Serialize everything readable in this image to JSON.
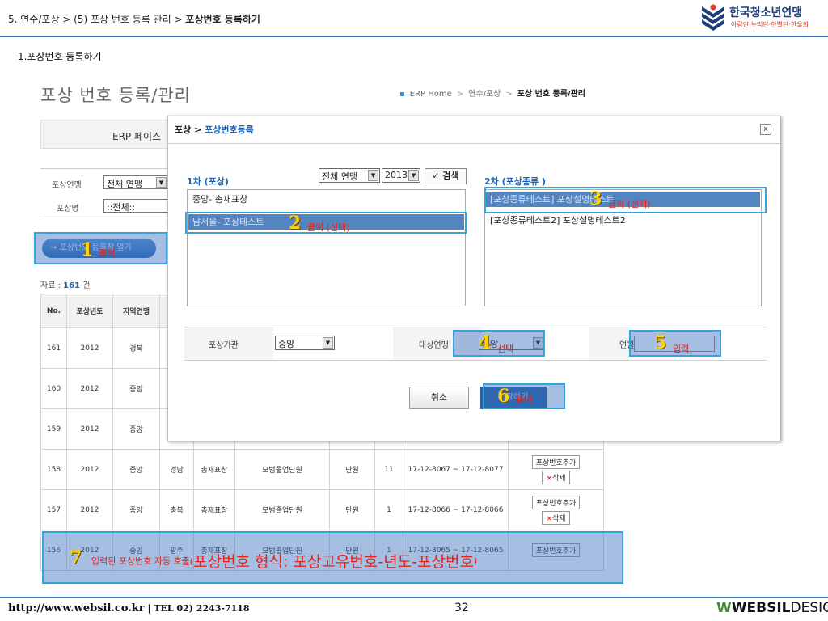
{
  "header": {
    "breadcrumb_path": "5. 연수/포상 > (5) 포상 번호 등록 관리 > ",
    "breadcrumb_current": "포상번호 등록하기",
    "brand_name": "한국청소년연맹",
    "brand_sub": "아람단·누리단·한별단·한울회"
  },
  "step_title": "1.포상번호 등록하기",
  "erp": {
    "page_title": "포상 번호 등록/관리",
    "crumbs": [
      "ERP Home",
      "연수/포상"
    ],
    "crumb_current": "포상 번호 등록/관리",
    "notice": "ERP 페이스",
    "filter": {
      "league_label": "포상연맹",
      "league_value": "전체 연맹",
      "award_label": "포상명",
      "award_value": "::전체::"
    },
    "open_button": "포상번호 등록창 열기",
    "count_label": "자료 : ",
    "count_value": "161",
    "count_unit": " 건",
    "table": {
      "headers": [
        "No.",
        "포상년도",
        "지역연맹"
      ],
      "rows": [
        {
          "no": "161",
          "year": "2012",
          "region": "경북"
        },
        {
          "no": "160",
          "year": "2012",
          "region": "중앙"
        },
        {
          "no": "159",
          "year": "2012",
          "region": "중앙"
        },
        {
          "no": "158",
          "year": "2012",
          "region": "중앙",
          "league": "경남",
          "award": "총재표창",
          "group": "모범졸업단원",
          "type": "단원",
          "qty": "11",
          "range": "17-12-8067 ~ 17-12-8077"
        },
        {
          "no": "157",
          "year": "2012",
          "region": "중앙",
          "league": "충북",
          "award": "총재표창",
          "group": "모범졸업단원",
          "type": "단원",
          "qty": "1",
          "range": "17-12-8066 ~ 17-12-8066"
        },
        {
          "no": "156",
          "year": "2012",
          "region": "중앙",
          "league": "광주",
          "award": "총재표창",
          "group": "모범졸업단원",
          "type": "단원",
          "qty": "1",
          "range": "17-12-8065 ~ 17-12-8065"
        }
      ],
      "add_button": "포상번호추가",
      "delete_button": "삭제"
    }
  },
  "modal": {
    "title_prefix": "포상 > ",
    "title_current": "포상번호등록",
    "close": "x",
    "first_label": "1차 (포상)",
    "first_league_select": "전체 연맹",
    "first_year_select": "2013",
    "search_button": "검색",
    "first_items": [
      "중앙- 총재표창",
      "남서울- 포상테스트"
    ],
    "second_label": "2차 (포상종류 )",
    "second_items": [
      "[포상종류테스트] 포상설명테스트",
      "[포상종류테스트2] 포상설명테스트2"
    ],
    "form": {
      "org_label": "포상기관",
      "org_value": "중앙",
      "target_label": "대상연맹",
      "target_value": "중앙",
      "year_label": "연월"
    },
    "cancel_button": "취소",
    "save_button": "저장하기"
  },
  "steps": {
    "s1": {
      "num": "1",
      "caption": "클릭"
    },
    "s2": {
      "num": "2",
      "caption": "클릭 (선택)"
    },
    "s3": {
      "num": "3",
      "caption": "클릭 (선택)"
    },
    "s4": {
      "num": "4",
      "caption": "선택"
    },
    "s5": {
      "num": "5",
      "caption": "입력"
    },
    "s6": {
      "num": "6",
      "caption": "클릭"
    },
    "s7": {
      "num": "7",
      "caption_small": "입력된 포상번호 자동 호출(",
      "caption_big": "포상번호 형식: 포상고유번호-년도-포상번호",
      "caption_end": ")"
    }
  },
  "footer": {
    "url": "http://www.websil.co.kr",
    "tel": " | TEL 02) 2243-7118",
    "page": "32",
    "logo_bold": "WEBSIL",
    "logo_light": "DESIGN"
  }
}
